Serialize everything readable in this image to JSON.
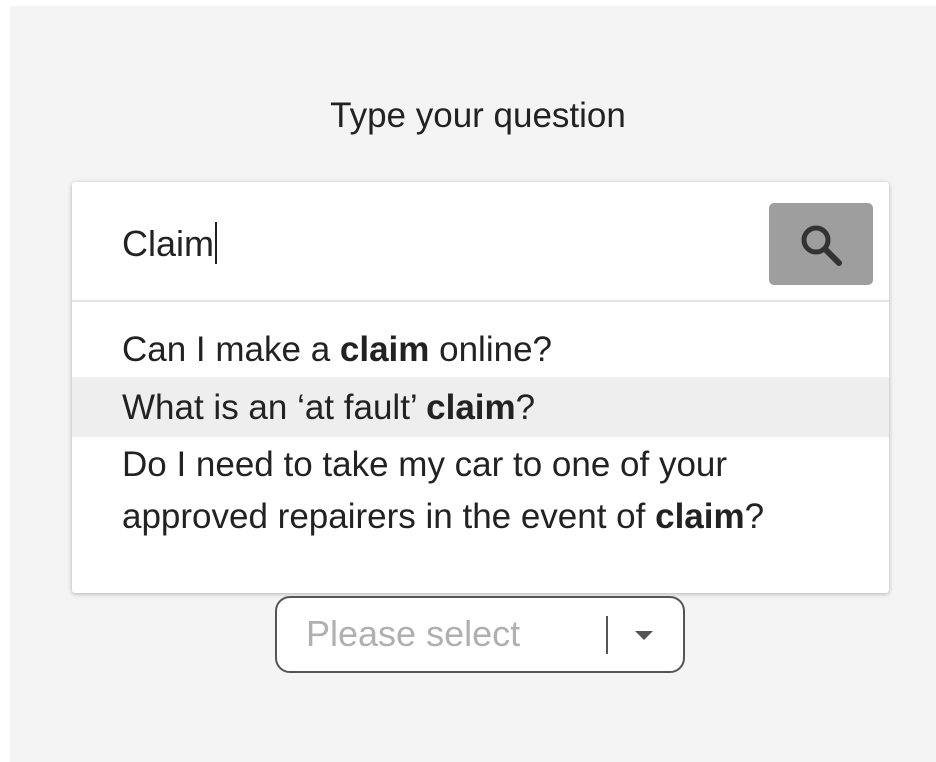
{
  "heading": "Type your question",
  "search": {
    "value": "Claim",
    "button_icon": "search-icon"
  },
  "suggestions": [
    {
      "before": "Can I make a ",
      "match": "claim",
      "after": " online?"
    },
    {
      "before": "What is an ‘at fault’ ",
      "match": "claim",
      "after": "?"
    },
    {
      "before": "Do I need to take my car to one of your approved repairers in the event of ",
      "match": "claim",
      "after": "?"
    }
  ],
  "select": {
    "placeholder": "Please select",
    "arrow_icon": "caret-down-icon"
  },
  "colors": {
    "panel_background": "#f4f4f4",
    "search_button": "#9e9e9e",
    "highlight_row": "#eeeeee",
    "placeholder_text": "#b0b0b0"
  }
}
